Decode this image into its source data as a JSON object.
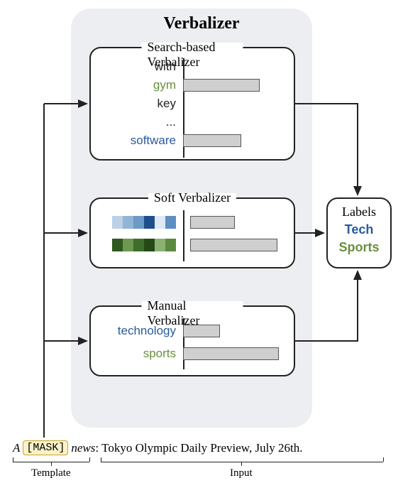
{
  "title": "Verbalizer",
  "search_box": {
    "title": "Search-based Verbalizer",
    "words": [
      "with",
      "gym",
      "key",
      "...",
      "software"
    ]
  },
  "soft_box": {
    "title": "Soft Verbalizer"
  },
  "manual_box": {
    "title": "Manual Verbalizer",
    "words": [
      "technology",
      "sports"
    ]
  },
  "labels": {
    "title": "Labels",
    "items": [
      "Tech",
      "Sports"
    ]
  },
  "sentence": {
    "prefix_a": "A",
    "mask": "[MASK]",
    "news": "news",
    "colon": ":",
    "input": "Tokyo Olympic Daily Preview, July 26th."
  },
  "bottom": {
    "template_label": "Template",
    "input_label": "Input"
  },
  "chart_data": [
    {
      "type": "bar",
      "title": "Search-based Verbalizer",
      "categories": [
        "with",
        "gym",
        "key",
        "...",
        "software"
      ],
      "values": [
        0,
        0.72,
        0,
        null,
        0.55
      ],
      "xlim": [
        0,
        1
      ]
    },
    {
      "type": "bar",
      "title": "Soft Verbalizer",
      "categories": [
        "embedding-blue",
        "embedding-green"
      ],
      "values": [
        0.42,
        0.82
      ],
      "xlim": [
        0,
        1
      ],
      "note": "categories are learned soft embeddings shown as color strips"
    },
    {
      "type": "bar",
      "title": "Manual Verbalizer",
      "categories": [
        "technology",
        "sports"
      ],
      "values": [
        0.35,
        0.9
      ],
      "xlim": [
        0,
        1
      ]
    }
  ]
}
